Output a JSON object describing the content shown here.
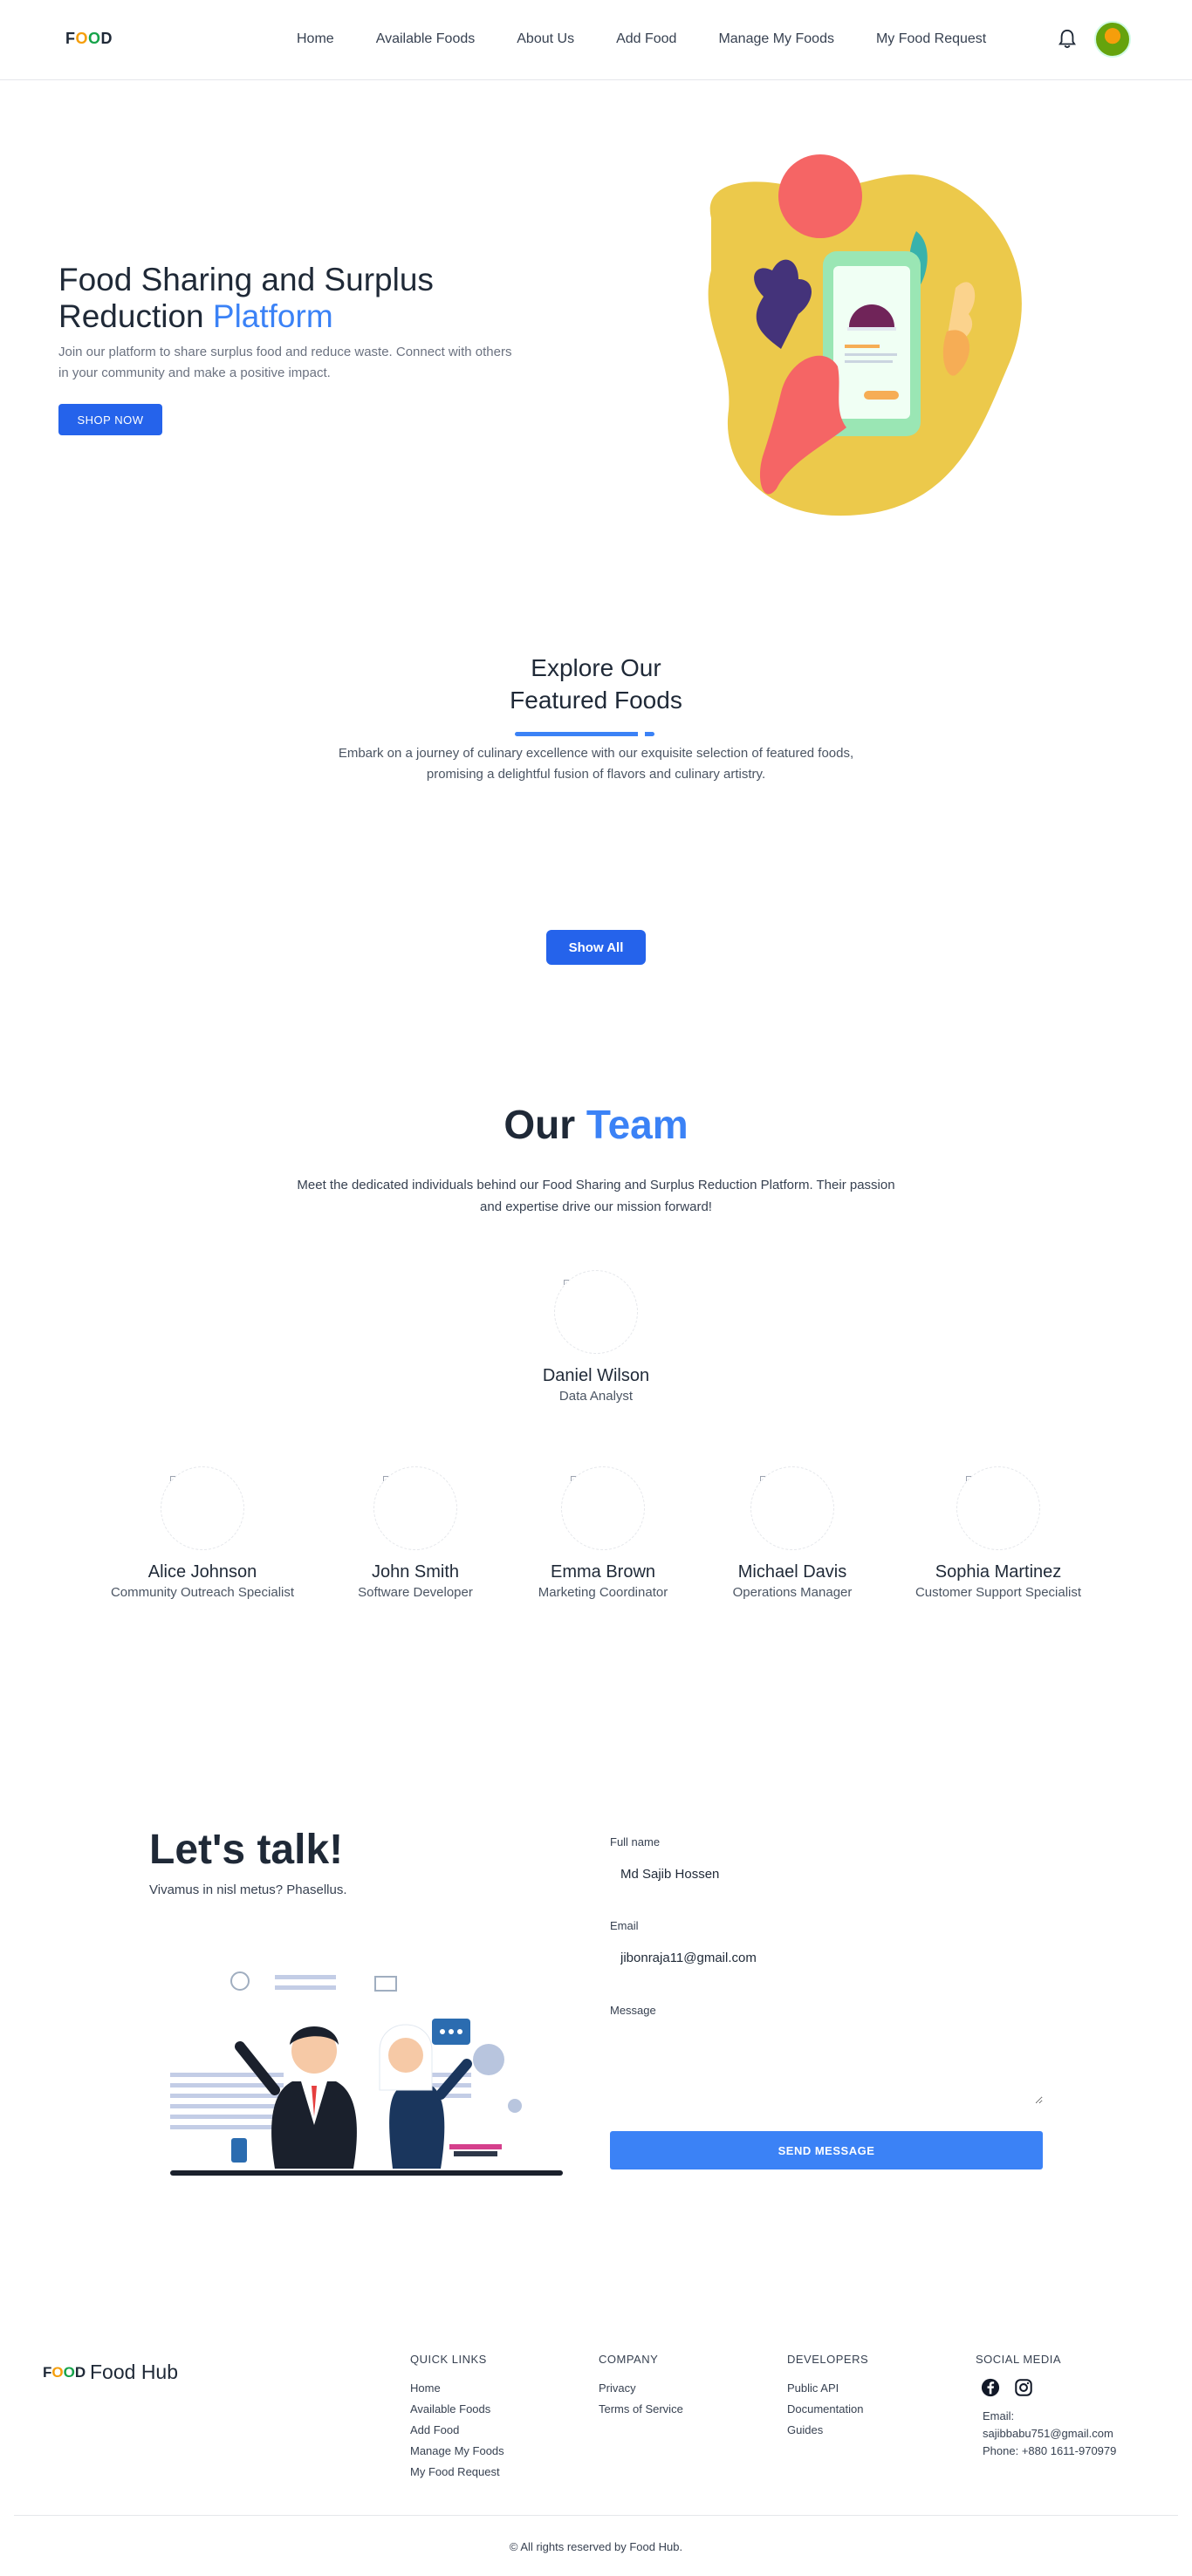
{
  "nav": {
    "logo": {
      "f": "F",
      "o1": "O",
      "o2": "O",
      "d": "D"
    },
    "links": [
      "Home",
      "Available Foods",
      "About Us",
      "Add Food",
      "Manage My Foods",
      "My Food Request"
    ]
  },
  "hero": {
    "title_main": "Food Sharing and Surplus Reduction ",
    "title_accent": "Platform",
    "description": "Join our platform to share surplus food and reduce waste. Connect with others in your community and make a positive impact.",
    "button": "SHOP NOW"
  },
  "featured": {
    "title_line1": "Explore Our",
    "title_line2": "Featured Foods",
    "description": "Embark on a journey of culinary excellence with our exquisite selection of featured foods, promising a delightful fusion of flavors and culinary artistry.",
    "button": "Show All"
  },
  "team": {
    "title_main": "Our ",
    "title_accent": "Team",
    "description": "Meet the dedicated individuals behind our Food Sharing and Surplus Reduction Platform. Their passion and expertise drive our mission forward!",
    "members": [
      {
        "name": "Daniel Wilson",
        "role": "Data Analyst"
      },
      {
        "name": "Alice Johnson",
        "role": "Community Outreach Specialist"
      },
      {
        "name": "John Smith",
        "role": "Software Developer"
      },
      {
        "name": "Emma Brown",
        "role": "Marketing Coordinator"
      },
      {
        "name": "Michael Davis",
        "role": "Operations Manager"
      },
      {
        "name": "Sophia Martinez",
        "role": "Customer Support Specialist"
      }
    ]
  },
  "contact": {
    "title": "Let's talk!",
    "subtitle": "Vivamus in nisl metus? Phasellus.",
    "fullname_label": "Full name",
    "fullname_value": "Md Sajib Hossen",
    "email_label": "Email",
    "email_value": "jibonraja11@gmail.com",
    "message_label": "Message",
    "button": "SEND MESSAGE"
  },
  "footer": {
    "brand": "Food Hub",
    "quick_links": {
      "heading": "QUICK LINKS",
      "items": [
        "Home",
        "Available Foods",
        "Add Food",
        "Manage My Foods",
        "My Food Request"
      ]
    },
    "company": {
      "heading": "COMPANY",
      "items": [
        "Privacy",
        "Terms of Service"
      ]
    },
    "developers": {
      "heading": "DEVELOPERS",
      "items": [
        "Public API",
        "Documentation",
        "Guides"
      ]
    },
    "social": {
      "heading": "SOCIAL MEDIA",
      "icons": [
        "facebook-icon",
        "instagram-icon"
      ]
    },
    "email_label": "Email:",
    "email": "sajibbabu751@gmail.com",
    "phone": "Phone: +880 1611-970979",
    "copyright": "© All rights reserved by Food Hub."
  },
  "colors": {
    "primary": "#2563eb",
    "accent": "#3b82f6",
    "text": "#1f2937"
  }
}
